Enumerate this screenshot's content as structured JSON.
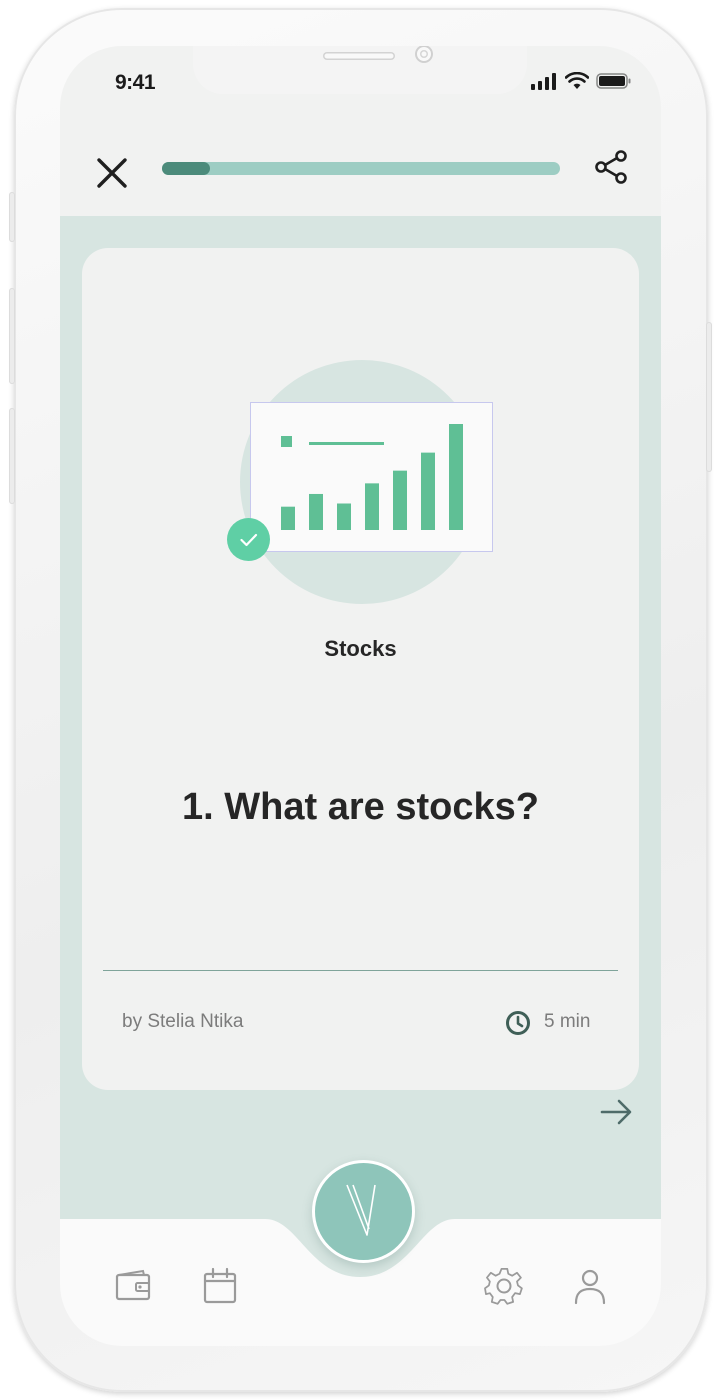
{
  "status_bar": {
    "time": "9:41",
    "icons": [
      "cellular-signal-icon",
      "wifi-icon",
      "battery-icon"
    ]
  },
  "top_bar": {
    "close_icon": "close-icon",
    "share_icon": "share-icon",
    "progress": 0.12
  },
  "card": {
    "illustration": {
      "type": "bar-chart-illustration",
      "bars": [
        0.22,
        0.34,
        0.25,
        0.44,
        0.56,
        0.73,
        1.0
      ],
      "check_badge": true
    },
    "category": "Stocks",
    "title": "1. What are stocks?",
    "author": "by Stelia Ntika",
    "duration": "5 min"
  },
  "next_icon": "arrow-right-icon",
  "bottom_nav": {
    "items": [
      "wallet-icon",
      "calendar-icon",
      "logo-icon",
      "gear-icon",
      "user-icon"
    ]
  },
  "colors": {
    "accent": "#5fbf95",
    "progress_fill": "#4c8b7b",
    "progress_track": "#9dcdc3",
    "content_bg": "#d7e5e1",
    "card_bg": "#f1f2f1",
    "check_badge": "#5fcfa5",
    "logo_bg": "#8ec5ba"
  }
}
